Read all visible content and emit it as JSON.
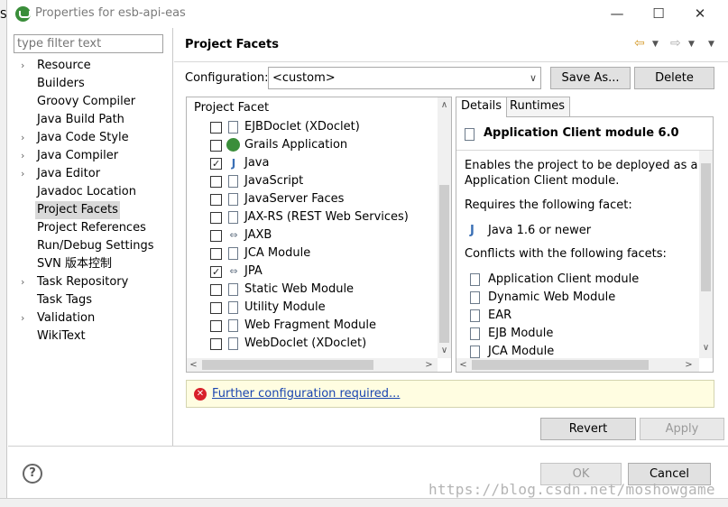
{
  "window": {
    "title": "Properties for esb-api-eas",
    "left_strip_text": "S"
  },
  "window_controls": {
    "minimize": "—",
    "maximize": "☐",
    "close": "✕"
  },
  "filter": {
    "placeholder": "type filter text"
  },
  "tree": [
    {
      "label": "Resource",
      "expandable": true,
      "selected": false
    },
    {
      "label": "Builders",
      "expandable": false,
      "selected": false
    },
    {
      "label": "Groovy Compiler",
      "expandable": false,
      "selected": false
    },
    {
      "label": "Java Build Path",
      "expandable": false,
      "selected": false
    },
    {
      "label": "Java Code Style",
      "expandable": true,
      "selected": false
    },
    {
      "label": "Java Compiler",
      "expandable": true,
      "selected": false
    },
    {
      "label": "Java Editor",
      "expandable": true,
      "selected": false
    },
    {
      "label": "Javadoc Location",
      "expandable": false,
      "selected": false
    },
    {
      "label": "Project Facets",
      "expandable": false,
      "selected": true
    },
    {
      "label": "Project References",
      "expandable": false,
      "selected": false
    },
    {
      "label": "Run/Debug Settings",
      "expandable": false,
      "selected": false
    },
    {
      "label": "SVN 版本控制",
      "expandable": false,
      "selected": false
    },
    {
      "label": "Task Repository",
      "expandable": true,
      "selected": false
    },
    {
      "label": "Task Tags",
      "expandable": false,
      "selected": false
    },
    {
      "label": "Validation",
      "expandable": true,
      "selected": false
    },
    {
      "label": "WikiText",
      "expandable": false,
      "selected": false
    }
  ],
  "page": {
    "title": "Project Facets",
    "configuration_label": "Configuration:",
    "configuration_value": "<custom>",
    "save_as_label": "Save As...",
    "delete_label": "Delete"
  },
  "facets": {
    "header": "Project Facet",
    "items": [
      {
        "label": "EJBDoclet (XDoclet)",
        "checked": false,
        "icon": "doc-icon"
      },
      {
        "label": "Grails Application",
        "checked": false,
        "icon": "grails-icon"
      },
      {
        "label": "Java",
        "checked": true,
        "icon": "java-icon"
      },
      {
        "label": "JavaScript",
        "checked": false,
        "icon": "doc-icon"
      },
      {
        "label": "JavaServer Faces",
        "checked": false,
        "icon": "doc-icon"
      },
      {
        "label": "JAX-RS (REST Web Services)",
        "checked": false,
        "icon": "doc-icon"
      },
      {
        "label": "JAXB",
        "checked": false,
        "icon": "jaxb-icon"
      },
      {
        "label": "JCA Module",
        "checked": false,
        "icon": "doc-icon"
      },
      {
        "label": "JPA",
        "checked": true,
        "icon": "jaxb-icon"
      },
      {
        "label": "Static Web Module",
        "checked": false,
        "icon": "doc-icon"
      },
      {
        "label": "Utility Module",
        "checked": false,
        "icon": "doc-icon"
      },
      {
        "label": "Web Fragment Module",
        "checked": false,
        "icon": "doc-icon"
      },
      {
        "label": "WebDoclet (XDoclet)",
        "checked": false,
        "icon": "doc-icon"
      }
    ]
  },
  "details": {
    "tabs": [
      "Details",
      "Runtimes"
    ],
    "title": "Application Client module 6.0",
    "description_line1": "Enables the project to be deployed as a Java",
    "description_line2": "Application Client module.",
    "requires_label": "Requires the following facet:",
    "requires_item": "Java 1.6 or newer",
    "conflicts_label": "Conflicts with the following facets:",
    "conflicts": [
      "Application Client module",
      "Dynamic Web Module",
      "EAR",
      "EJB Module",
      "JCA Module"
    ]
  },
  "message": {
    "text": "Further configuration required..."
  },
  "buttons": {
    "revert": "Revert",
    "apply": "Apply",
    "ok": "OK",
    "cancel": "Cancel"
  },
  "help": {
    "glyph": "?"
  },
  "watermark": "https://blog.csdn.net/moshowgame"
}
